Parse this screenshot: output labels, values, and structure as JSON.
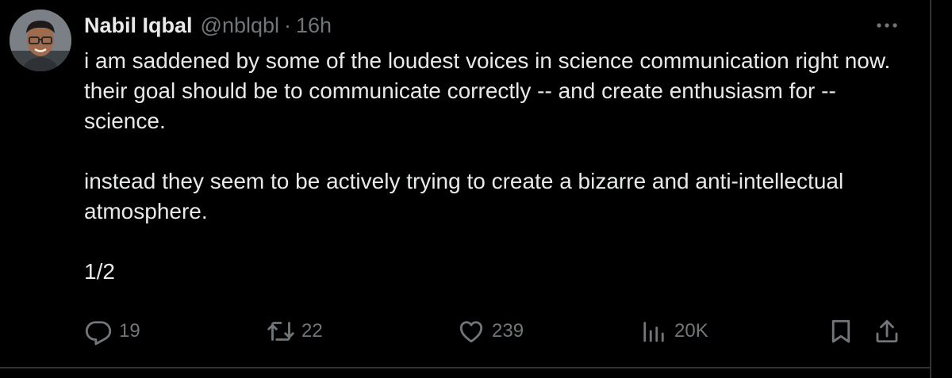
{
  "tweet": {
    "author_name": "Nabil Iqbal",
    "handle": "@nblqbl",
    "separator": "·",
    "time": "16h",
    "paragraphs": [
      "i am saddened by some of the loudest voices in science communication right now. their goal should be to communicate correctly -- and create enthusiasm for -- science.",
      "instead they seem to be actively trying to create a bizarre and anti-intellectual atmosphere.",
      "1/2"
    ]
  },
  "actions": {
    "replies": "19",
    "reposts": "22",
    "likes": "239",
    "views": "20K"
  },
  "icons": {
    "more": "more-options-icon",
    "reply": "reply-icon",
    "repost": "repost-icon",
    "like": "heart-icon",
    "views": "views-chart-icon",
    "bookmark": "bookmark-icon",
    "share": "share-icon"
  },
  "colors": {
    "background": "#000000",
    "text": "#e7e9ea",
    "secondary": "#71767b",
    "border": "#2f3336"
  }
}
